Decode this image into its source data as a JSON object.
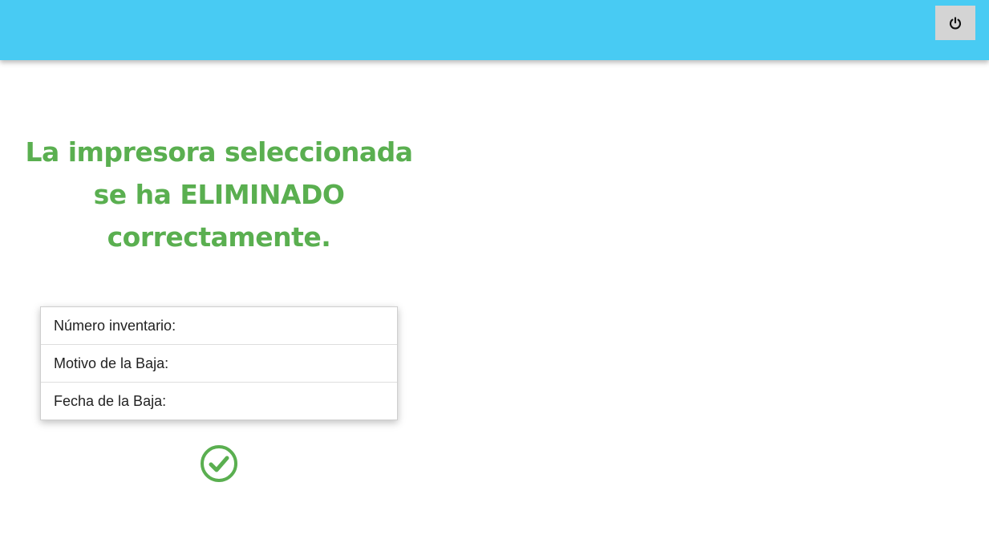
{
  "header": {
    "background_color": "#48cbf3",
    "power_button": {
      "icon": "power-icon",
      "background_color": "#d4d4d4"
    }
  },
  "message": {
    "line1": "La impresora seleccionada",
    "line2": "se ha ELIMINADO",
    "line3": "correctamente.",
    "color": "#5aaf50"
  },
  "details": {
    "items": [
      {
        "label": "Número inventario:"
      },
      {
        "label": "Motivo de la Baja:"
      },
      {
        "label": "Fecha de la Baja:"
      }
    ]
  },
  "status_icon": {
    "icon": "check-circle-icon",
    "color": "#5aaf50"
  }
}
